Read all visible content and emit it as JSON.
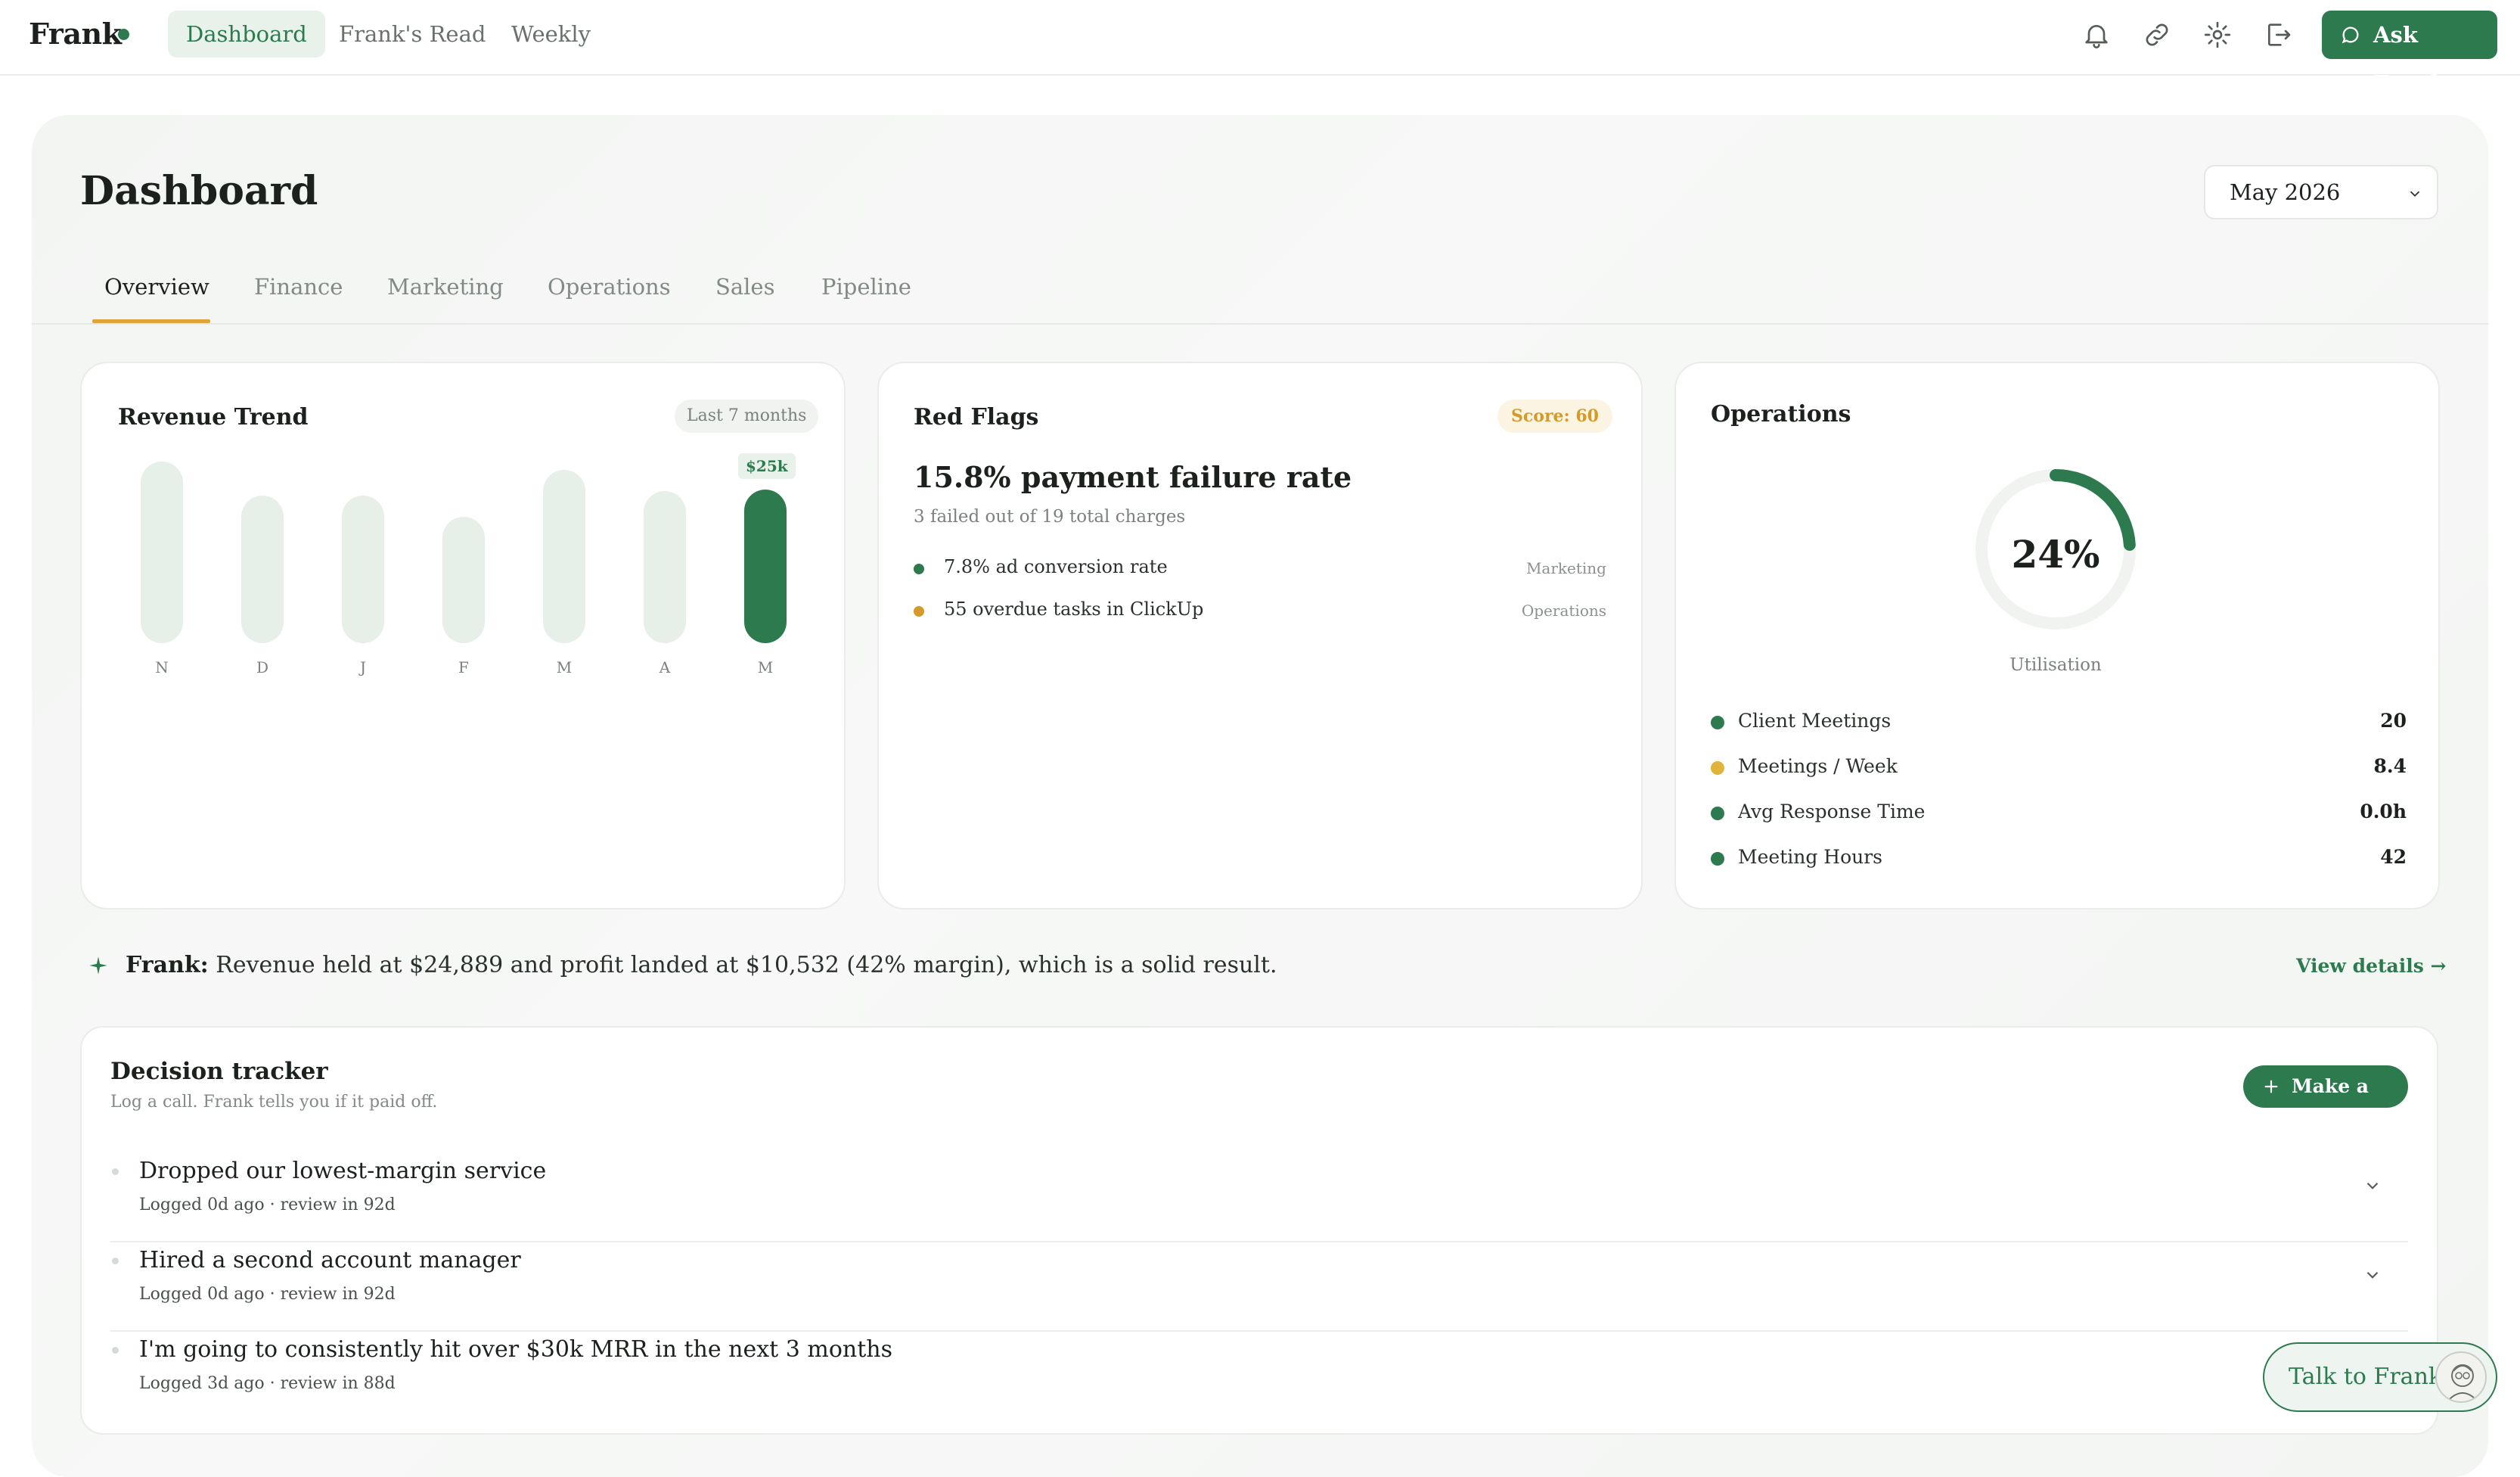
{
  "brand": {
    "name": "Frank",
    "accent": "#2d7a4f",
    "amber": "#e0a43a"
  },
  "nav": {
    "items": [
      {
        "label": "Dashboard",
        "active": true
      },
      {
        "label": "Frank's Read",
        "active": false
      },
      {
        "label": "Weekly",
        "active": false
      }
    ],
    "icons": [
      "bell-icon",
      "link-icon",
      "gear-icon",
      "logout-icon"
    ],
    "ask_label": "Ask Frank"
  },
  "header": {
    "title": "Dashboard",
    "month": "May 2026"
  },
  "tabs": [
    {
      "label": "Overview",
      "active": true
    },
    {
      "label": "Finance",
      "active": false
    },
    {
      "label": "Marketing",
      "active": false
    },
    {
      "label": "Operations",
      "active": false
    },
    {
      "label": "Sales",
      "active": false
    },
    {
      "label": "Pipeline",
      "active": false
    }
  ],
  "revenue": {
    "title": "Revenue Trend",
    "range": "Last 7 months",
    "latest_label": "$25k"
  },
  "chart_data": {
    "type": "bar",
    "categories": [
      "N",
      "D",
      "J",
      "F",
      "M",
      "A",
      "M"
    ],
    "values": [
      22.4,
      18.2,
      18.2,
      15.6,
      21.4,
      18.8,
      18.9
    ],
    "highlight_index": 6,
    "title": "Revenue Trend"
  },
  "red_flags": {
    "title": "Red Flags",
    "score": "Score: 60",
    "headline": "15.8% payment failure rate",
    "subline": "3 failed out of 19 total charges",
    "items": [
      {
        "text": "7.8% ad conversion rate",
        "tag": "Marketing",
        "color": "#2d7a4f"
      },
      {
        "text": "55 overdue tasks in ClickUp",
        "tag": "Operations",
        "color": "#d49a2a"
      }
    ]
  },
  "operations": {
    "title": "Operations",
    "gauge_value": "24%",
    "gauge_fraction": 0.24,
    "gauge_caption": "Utilisation",
    "metrics": [
      {
        "label": "Client Meetings",
        "value": "20",
        "color": "#2d7a4f"
      },
      {
        "label": "Meetings / Week",
        "value": "8.4",
        "color": "#e0b33a"
      },
      {
        "label": "Avg Response Time",
        "value": "0.0h",
        "color": "#2d7a4f"
      },
      {
        "label": "Meeting Hours",
        "value": "42",
        "color": "#2d7a4f"
      }
    ]
  },
  "insight": {
    "speaker": "Frank:",
    "text": "Revenue held at $24,889 and profit landed at $10,532 (42% margin), which is a solid result.",
    "link": "View details →"
  },
  "tracker": {
    "title": "Decision tracker",
    "subtitle": "Log a call. Frank tells you if it paid off.",
    "button": "Make a call",
    "rows": [
      {
        "title": "Dropped our lowest-margin service",
        "meta": "Logged 0d ago · review in 92d"
      },
      {
        "title": "Hired a second account manager",
        "meta": "Logged 0d ago · review in 92d"
      },
      {
        "title": "I'm going to consistently hit over $30k MRR in the next 3 months",
        "meta": "Logged 3d ago · review in 88d"
      }
    ]
  },
  "talk": {
    "label": "Talk to Frank"
  }
}
